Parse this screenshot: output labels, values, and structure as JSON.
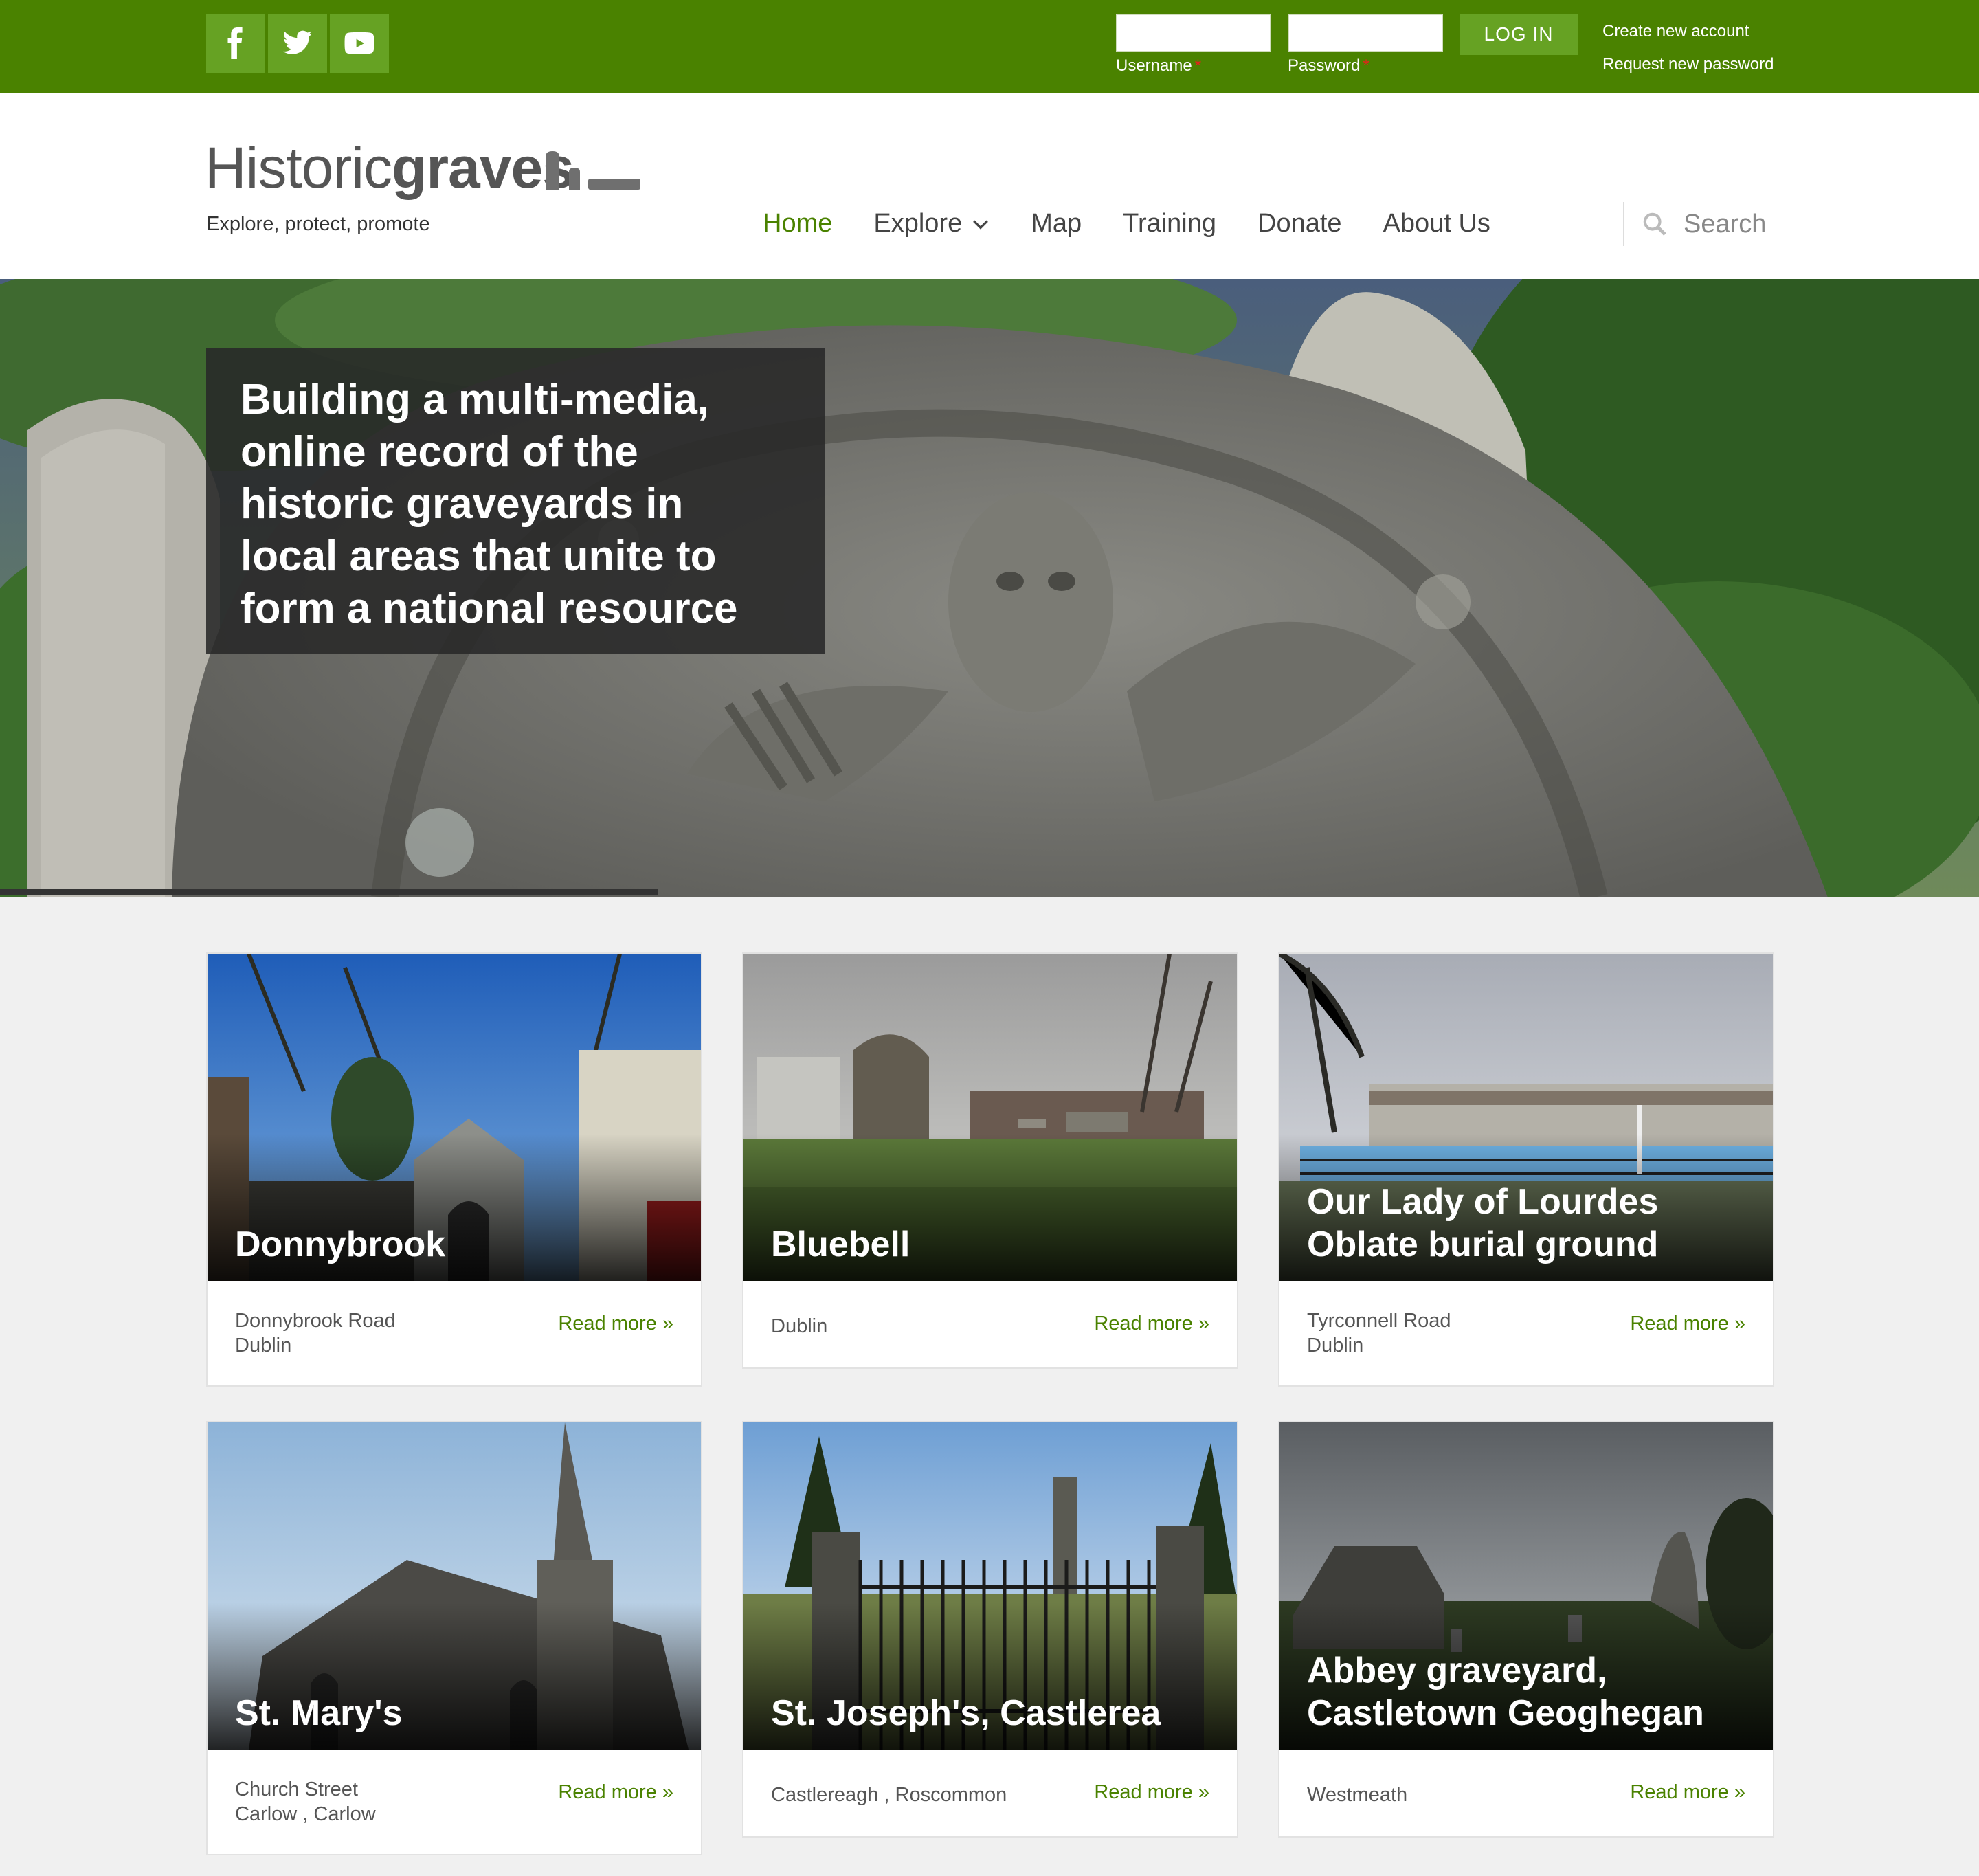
{
  "topbar": {
    "social": [
      {
        "icon": "facebook-icon"
      },
      {
        "icon": "twitter-icon"
      },
      {
        "icon": "youtube-icon"
      }
    ],
    "username_label": "Username",
    "password_label": "Password",
    "required_mark": "*",
    "login_label": "LOG IN",
    "create_account": "Create new account",
    "request_password": "Request new password"
  },
  "header": {
    "logo_part1": "Historic",
    "logo_part2": "graves",
    "tagline": "Explore, protect, promote",
    "nav": [
      {
        "label": "Home",
        "active": true
      },
      {
        "label": "Explore",
        "has_dropdown": true
      },
      {
        "label": "Map"
      },
      {
        "label": "Training"
      },
      {
        "label": "Donate"
      },
      {
        "label": "About Us"
      }
    ],
    "search_placeholder": "Search"
  },
  "hero": {
    "caption_lines": [
      "Building a multi-media,",
      "online record of the",
      "historic graveyards in",
      "local areas that unite to",
      "form a national resource"
    ]
  },
  "cards": [
    {
      "title_lines": [
        "Donnybrook"
      ],
      "address_lines": [
        "Donnybrook Road",
        "Dublin"
      ],
      "read_more": "Read more »"
    },
    {
      "title_lines": [
        "Bluebell"
      ],
      "address_lines": [
        "Dublin"
      ],
      "read_more": "Read more »"
    },
    {
      "title_lines": [
        "Our Lady of Lourdes",
        "Oblate burial ground"
      ],
      "address_lines": [
        "Tyrconnell Road",
        "Dublin"
      ],
      "read_more": "Read more »"
    },
    {
      "title_lines": [
        "St. Mary's"
      ],
      "address_lines": [
        "Church Street",
        "Carlow , Carlow"
      ],
      "read_more": "Read more »"
    },
    {
      "title_lines": [
        "St. Joseph's, Castlerea"
      ],
      "address_lines": [
        "Castlereagh , Roscommon"
      ],
      "read_more": "Read more »"
    },
    {
      "title_lines": [
        "Abbey graveyard,",
        "Castletown Geoghegan"
      ],
      "address_lines": [
        "Westmeath"
      ],
      "read_more": "Read more »"
    }
  ],
  "colors": {
    "brand_green": "#4a8200",
    "light_green": "#66a223"
  }
}
